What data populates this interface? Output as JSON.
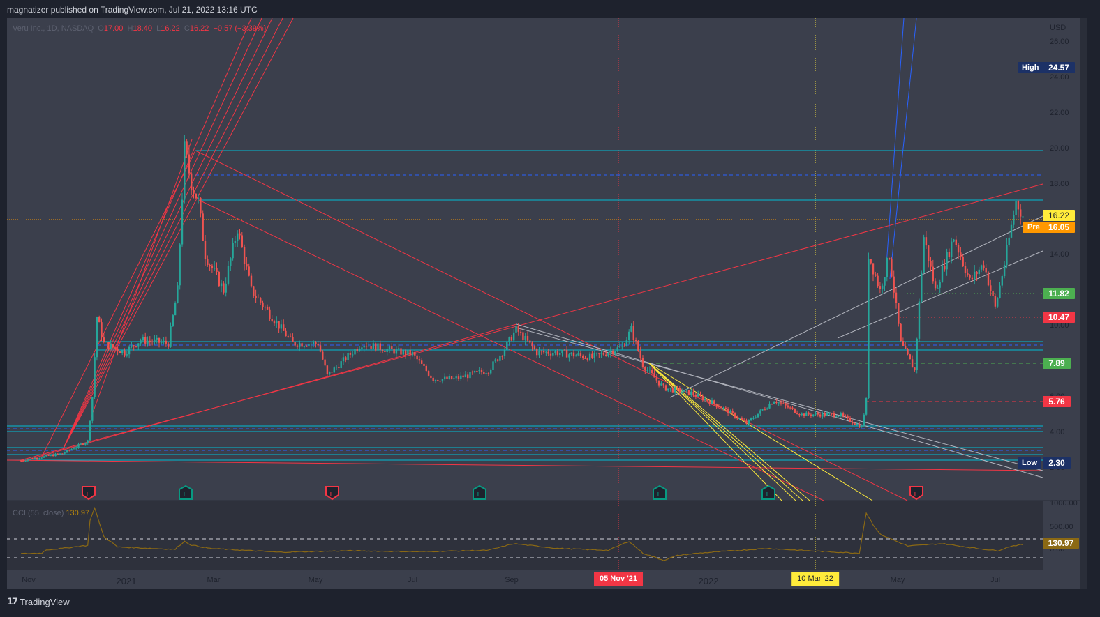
{
  "header": {
    "published": "magnatizer published on TradingView.com, Jul 21, 2022 13:16 UTC"
  },
  "legend": {
    "symbol": "Veru Inc., 1D, NASDAQ",
    "o_label": "O",
    "open": "17.00",
    "h_label": "H",
    "high": "18.40",
    "l_label": "L",
    "low": "16.22",
    "c_label": "C",
    "close": "16.22",
    "change": "−0.57 (−3.39%)"
  },
  "cci": {
    "label": "CCI (55, close)",
    "value": "130.97",
    "axis": [
      "1000.00",
      "500.00",
      "0.00"
    ]
  },
  "price_axis": {
    "currency": "USD",
    "ticks": [
      "26.00",
      "24.00",
      "22.00",
      "20.00",
      "18.00",
      "14.00",
      "10.00",
      "6.00",
      "4.00",
      "2.00"
    ]
  },
  "tags": {
    "high_label": "High",
    "high": "24.57",
    "last": "16.22",
    "pre_label": "Pre",
    "pre": "16.05",
    "t1": "11.82",
    "t2": "10.47",
    "t3": "7.89",
    "t4": "5.76",
    "low_label": "Low",
    "low": "2.30",
    "cci_val": "130.97"
  },
  "time_axis": {
    "labels": [
      "Nov",
      "2021",
      "Mar",
      "May",
      "Jul",
      "Sep",
      "2022",
      "May",
      "Jul"
    ],
    "hl1": "05 Nov '21",
    "hl2": "10 Mar '22"
  },
  "earnings_marker": "E",
  "footer": {
    "brand": "TradingView"
  },
  "colors": {
    "up": "#26a69a",
    "down": "#ef5350",
    "cci": "#8b6914",
    "bg": "#3b3f4c"
  },
  "chart_data": {
    "type": "candlestick",
    "price_keypoints": [
      [
        0,
        2.4
      ],
      [
        18,
        2.8
      ],
      [
        29,
        3.5
      ],
      [
        31,
        6
      ],
      [
        33,
        10.5
      ],
      [
        36,
        9
      ],
      [
        45,
        8.5
      ],
      [
        52,
        9.2
      ],
      [
        64,
        9
      ],
      [
        68,
        12
      ],
      [
        71,
        20
      ],
      [
        74,
        18
      ],
      [
        77,
        17
      ],
      [
        80,
        14
      ],
      [
        88,
        12
      ],
      [
        94,
        15.5
      ],
      [
        100,
        12
      ],
      [
        106,
        11
      ],
      [
        118,
        9
      ],
      [
        129,
        9
      ],
      [
        133,
        7.2
      ],
      [
        148,
        9
      ],
      [
        161,
        8.6
      ],
      [
        170,
        8.4
      ],
      [
        179,
        7
      ],
      [
        188,
        7
      ],
      [
        203,
        7.5
      ],
      [
        209,
        8.5
      ],
      [
        215,
        9.8
      ],
      [
        224,
        8.5
      ],
      [
        233,
        8.5
      ],
      [
        248,
        8.2
      ],
      [
        261,
        8.8
      ],
      [
        265,
        9.8
      ],
      [
        270,
        7.8
      ],
      [
        279,
        6.5
      ],
      [
        291,
        6.2
      ],
      [
        303,
        5.5
      ],
      [
        315,
        4.5
      ],
      [
        327,
        5.8
      ],
      [
        339,
        5
      ],
      [
        355,
        5
      ],
      [
        365,
        4.3
      ],
      [
        367,
        5.8
      ],
      [
        368,
        14
      ],
      [
        373,
        12
      ],
      [
        377,
        14
      ],
      [
        382,
        9
      ],
      [
        388,
        7.5
      ],
      [
        392,
        15
      ],
      [
        397,
        12
      ],
      [
        405,
        15
      ],
      [
        412,
        12.5
      ],
      [
        418,
        13.5
      ],
      [
        423,
        11
      ],
      [
        427,
        13.5
      ],
      [
        432,
        17
      ],
      [
        435,
        16.2
      ]
    ],
    "cci_keypoints": [
      [
        0,
        -60
      ],
      [
        9,
        -50
      ],
      [
        11,
        20
      ],
      [
        18,
        50
      ],
      [
        26,
        100
      ],
      [
        29,
        110
      ],
      [
        30,
        650
      ],
      [
        32,
        900
      ],
      [
        36,
        300
      ],
      [
        42,
        80
      ],
      [
        67,
        30
      ],
      [
        68,
        80
      ],
      [
        71,
        200
      ],
      [
        74,
        120
      ],
      [
        82,
        50
      ],
      [
        112,
        -30
      ],
      [
        142,
        0
      ],
      [
        173,
        -20
      ],
      [
        203,
        10
      ],
      [
        214,
        150
      ],
      [
        233,
        50
      ],
      [
        255,
        10
      ],
      [
        264,
        200
      ],
      [
        270,
        -50
      ],
      [
        279,
        -200
      ],
      [
        285,
        -100
      ],
      [
        294,
        -50
      ],
      [
        324,
        50
      ],
      [
        342,
        0
      ],
      [
        364,
        -50
      ],
      [
        367,
        800
      ],
      [
        370,
        550
      ],
      [
        373,
        350
      ],
      [
        385,
        100
      ],
      [
        400,
        150
      ],
      [
        415,
        50
      ],
      [
        424,
        0
      ],
      [
        430,
        100
      ],
      [
        435,
        131
      ]
    ],
    "ylim": [
      2,
      26
    ],
    "cci_ylim": [
      -300,
      1100
    ]
  }
}
